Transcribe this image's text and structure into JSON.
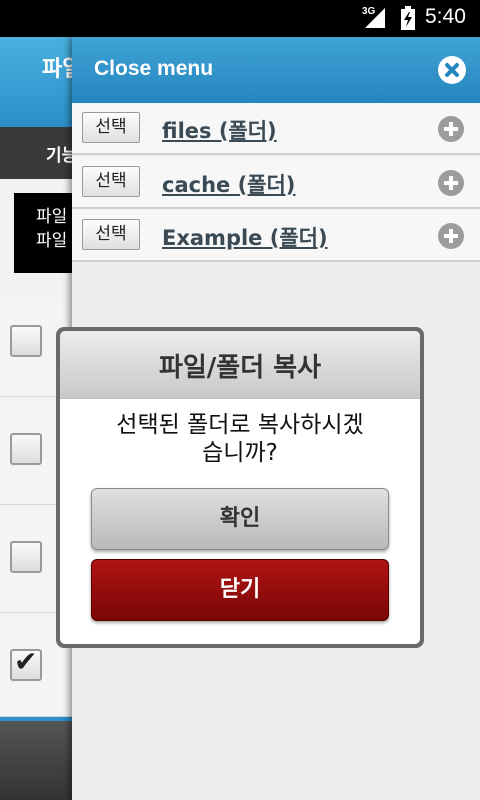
{
  "status_bar": {
    "network": "3G",
    "time": "5:40"
  },
  "background_app": {
    "header_title": "파일",
    "tab_label": "기능",
    "info_lines": [
      "파일",
      "파일"
    ],
    "rows": [
      {
        "checked": false
      },
      {
        "checked": false
      },
      {
        "checked": false
      },
      {
        "checked": true
      }
    ]
  },
  "drawer": {
    "title": "Close menu",
    "folders": [
      {
        "select_label": "선택",
        "name": "files (폴더)"
      },
      {
        "select_label": "선택",
        "name": "cache (폴더)"
      },
      {
        "select_label": "선택",
        "name": "Example (폴더)"
      }
    ]
  },
  "dialog": {
    "title": "파일/폴더 복사",
    "message_line1": "선택된 폴더로 복사하시겠",
    "message_line2": "습니까?",
    "confirm_label": "확인",
    "close_label": "닫기"
  },
  "colors": {
    "accent": "#2a8fc8",
    "danger": "#8b0a0a"
  }
}
